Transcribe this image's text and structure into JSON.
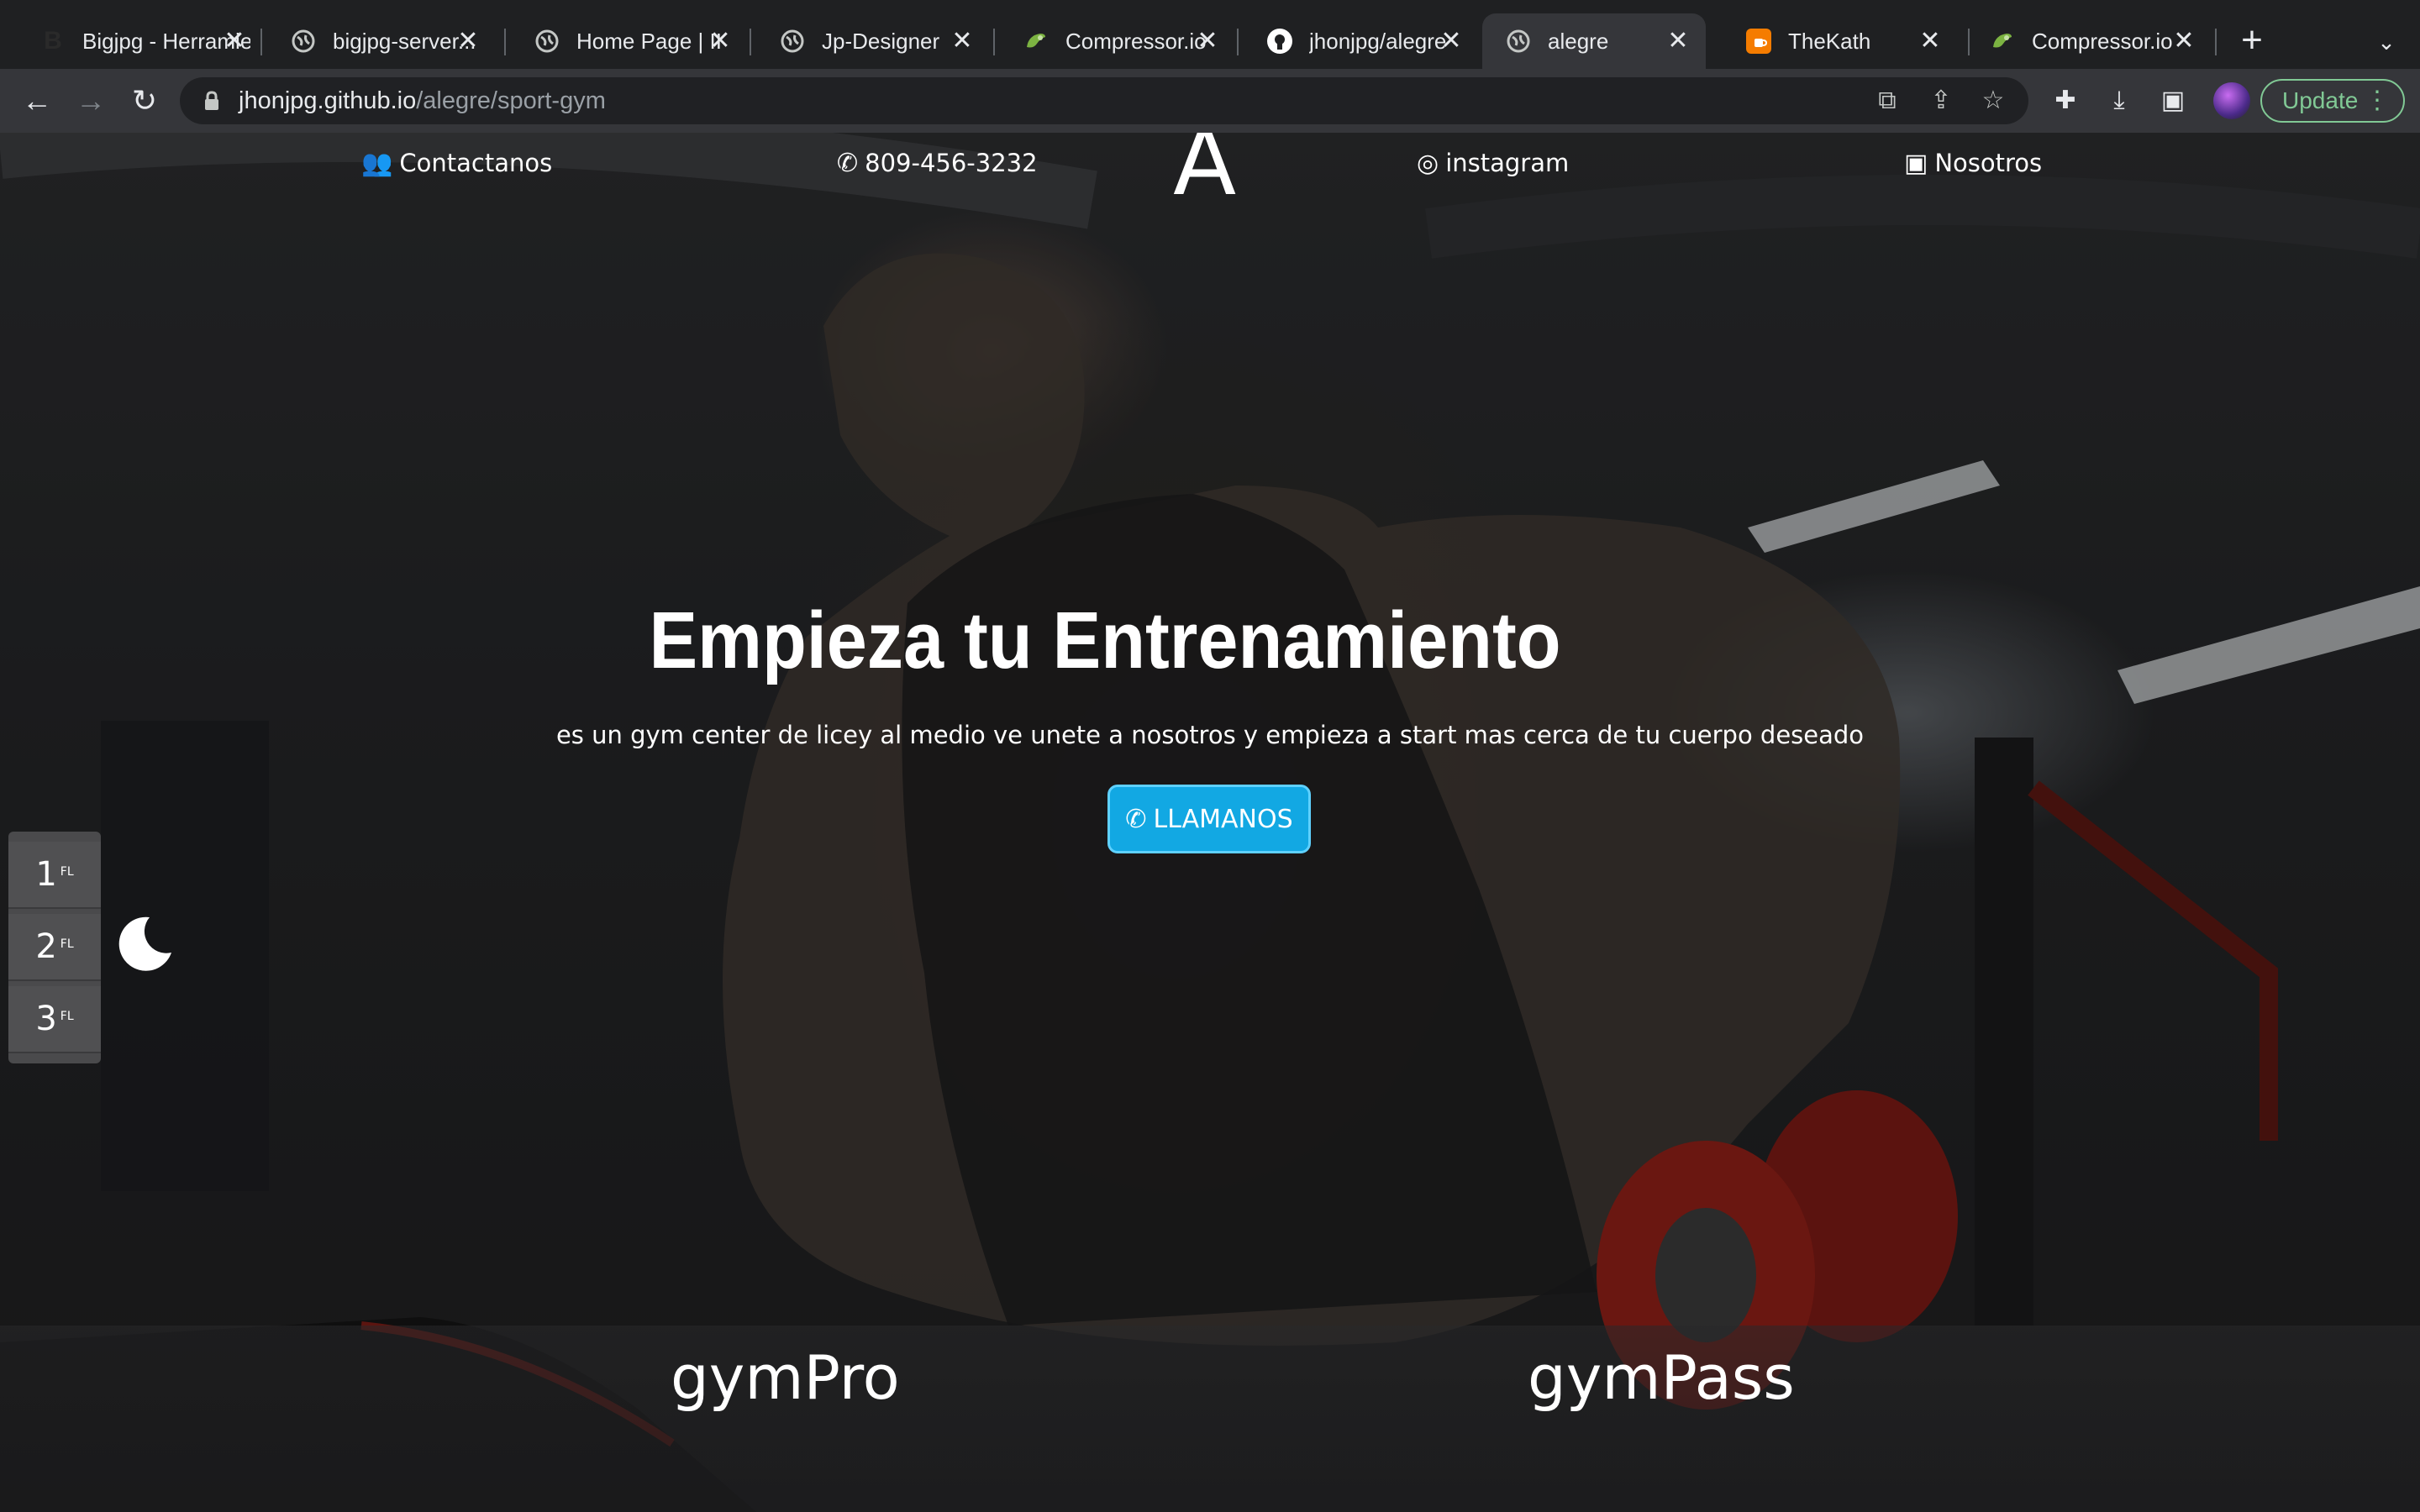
{
  "browser": {
    "tabs": [
      {
        "title": "Bigjpg - Herramienta",
        "favicon_letter": "B",
        "favicon_color": "#2a2a2a"
      },
      {
        "title": "bigjpg-server...",
        "favicon_letter": "",
        "favicon_color": "#9aa0a6"
      },
      {
        "title": "Home Page | II",
        "favicon_letter": "",
        "favicon_color": "#9aa0a6"
      },
      {
        "title": "Jp-Designer",
        "favicon_letter": "",
        "favicon_color": "#9aa0a6"
      },
      {
        "title": "Compressor.io",
        "favicon_letter": "",
        "favicon_color": "#7cb342"
      },
      {
        "title": "jhonjpg/alegre",
        "favicon_letter": "",
        "favicon_color": "#ffffff"
      },
      {
        "title": "alegre",
        "favicon_letter": "",
        "favicon_color": "#9aa0a6"
      },
      {
        "title": "TheKath",
        "favicon_letter": "",
        "favicon_color": "#f57c00"
      },
      {
        "title": "Compressor.io",
        "favicon_letter": "",
        "favicon_color": "#7cb342"
      }
    ],
    "active_tab": 6,
    "new_tab_label": "+",
    "tab_menu_label": "⌄",
    "url_host": "jhonjpg.github.io",
    "url_path": "/alegre/sport-gym",
    "update_label": "Update",
    "update_menu": "⋮",
    "close_glyph": "✕",
    "nav": {
      "back": "←",
      "forward": "→",
      "reload": "↻"
    },
    "omnibox_icons": {
      "translate": "⧉",
      "share": "⇪",
      "bookmark": "☆"
    },
    "toolbar_icons": {
      "extensions": "✚",
      "downloads": "⤓",
      "sidepanel": "▣"
    }
  },
  "site": {
    "nav": {
      "contact": {
        "icon": "👥",
        "label": "Contactanos"
      },
      "phone": {
        "icon": "✆",
        "label": "809-456-3232"
      },
      "logo": "A",
      "instagram": {
        "icon": "◎",
        "label": "instagram"
      },
      "about": {
        "icon": "▣",
        "label": "Nosotros"
      }
    },
    "hero": {
      "title": "Empieza tu Entrenamiento",
      "subtitle": "es un gym center de licey al medio ve unete a nosotros y empieza a start mas cerca de tu cuerpo deseado",
      "cta_icon": "✆",
      "cta_label": "LLAMANOS",
      "cta_color": "#12a8e3"
    },
    "floors": [
      {
        "number": "1",
        "suffix": "FL"
      },
      {
        "number": "2",
        "suffix": "FL"
      },
      {
        "number": "3",
        "suffix": "FL"
      }
    ],
    "plans": [
      "gymPro",
      "gymPass"
    ]
  }
}
